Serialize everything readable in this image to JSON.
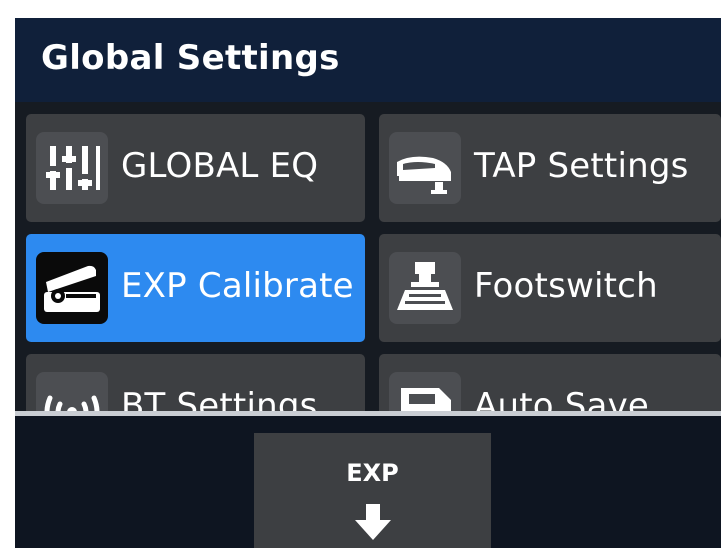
{
  "header": {
    "title": "Global Settings"
  },
  "tiles": [
    {
      "label": "GLOBAL EQ",
      "icon": "eq-sliders-icon",
      "selected": false
    },
    {
      "label": "TAP Settings",
      "icon": "tap-pedal-icon",
      "selected": false
    },
    {
      "label": "EXP Calibrate",
      "icon": "expression-pedal-icon",
      "selected": true
    },
    {
      "label": "Footswitch",
      "icon": "footswitch-icon",
      "selected": false
    },
    {
      "label": "BT Settings",
      "icon": "bluetooth-signal-icon",
      "selected": false
    },
    {
      "label": "Auto Save",
      "icon": "save-icon",
      "selected": false
    }
  ],
  "footer": {
    "exp_button_label": "EXP",
    "exp_button_icon": "arrow-down-icon"
  },
  "colors": {
    "header_bg": "#10203a",
    "tile_bg": "#3d3f42",
    "selected_tile_bg": "#2d8af0",
    "divider": "#c9cdd3"
  }
}
